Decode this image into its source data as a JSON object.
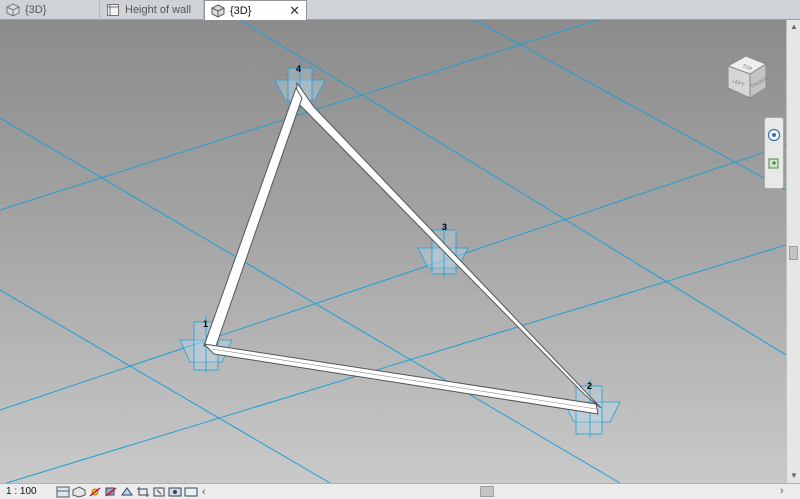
{
  "tabs": [
    {
      "label": "{3D}",
      "icon": "3d-view-icon",
      "active": false
    },
    {
      "label": "Height of wall",
      "icon": "sheet-view-icon",
      "active": false
    },
    {
      "label": "{3D}",
      "icon": "3d-view-icon",
      "active": true
    }
  ],
  "tab_close": "✕",
  "viewcube": {
    "top_label": "TOP",
    "front_label": "LEFT",
    "right_label": "FRONT"
  },
  "points": [
    {
      "label": "1"
    },
    {
      "label": "2"
    },
    {
      "label": "3"
    },
    {
      "label": "4"
    }
  ],
  "status": {
    "scale": "1 : 100",
    "view_controls": [
      "detail-level-icon",
      "visual-style-icon",
      "sun-path-icon",
      "shadows-icon",
      "render-icon",
      "crop-view-icon",
      "show-crop-icon",
      "temporary-hide-icon",
      "reveal-hidden-icon"
    ]
  },
  "colors": {
    "grid": "#1e9fd6",
    "viewport_top": "#8c8c8c",
    "viewport_bottom": "#c9c9c9",
    "wall": "#ffffff"
  }
}
